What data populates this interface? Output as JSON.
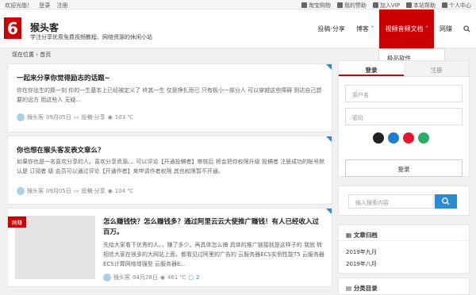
{
  "topbar": {
    "welcome": "欢迎光临！",
    "login": "登录",
    "register": "注册",
    "links": [
      "淘宝购物",
      "我的赞助",
      "加入VIP",
      "本站帮助",
      "个人中心"
    ]
  },
  "site": {
    "name": "猴头客",
    "desc": "学注分享优质免费视频教程、网络资源的休闲小站"
  },
  "nav": {
    "items": [
      "投稿·分享",
      "博客",
      "视频音频文档",
      "网赚"
    ],
    "active_index": 2,
    "dropdown": "极品软件"
  },
  "breadcrumb": "现在位置 › 首页",
  "posts": [
    {
      "title": "一起来分享你觉得励志的话题~",
      "excerpt": "你在你出生的那一刻 你的一生基本上已经被定义了 终其一生 仅是挣扎而已 只有极小一部分人 可以穿越这些障碍 到达自己想要的远方 而这些人 无疑...",
      "author": "猴头客",
      "date": "09月05日",
      "category": "投稿·分享",
      "views": "103 ℃"
    },
    {
      "title": "你也想在猴头客发表文章么？",
      "excerpt": "如果你也是一名喜欢分享的人。喜欢分享资源。，可以评论【开通投稿者】审核后 将会把你权限升级 投稿者 注册成功的帐号默认是 订阅者 级 会员可以通过评论【开通作者】来申请作者权限 其也权限暂不开通。",
      "author": "猴头客",
      "date": "09月05日",
      "category": "投稿·分享",
      "views": "104 ℃"
    },
    {
      "badge": "网赚",
      "title": "怎么赚钱快？怎么赚钱多？通过阿里云云大使推广赚钱！有人已经收入过百万。",
      "excerpt": "先给大家看下优秀的人。，赚了多少。再具体怎么搞 具体的推广链接就是这样子的 我就 转 相信大家在很多的大网站上面，都看见过阿里的广告的 云服务器ECS实例性能T5 云服务器ECS计算网络增强型 云服务器E...",
      "author": "猴头客",
      "date": "04月28日",
      "views": "461 ℃",
      "comments": "2"
    }
  ],
  "sidebar": {
    "tabs": [
      "登录",
      "注册"
    ],
    "username_placeholder": "用户名",
    "password_placeholder": "密码",
    "login_button": "登录",
    "search_placeholder": "输入搜索内容",
    "archive_title": "文章归档",
    "archives": [
      "2019年九月",
      "2019年八月"
    ],
    "category_title": "分类目录"
  },
  "colors": {
    "accent": "#cc0000",
    "link": "#2a88d4"
  }
}
